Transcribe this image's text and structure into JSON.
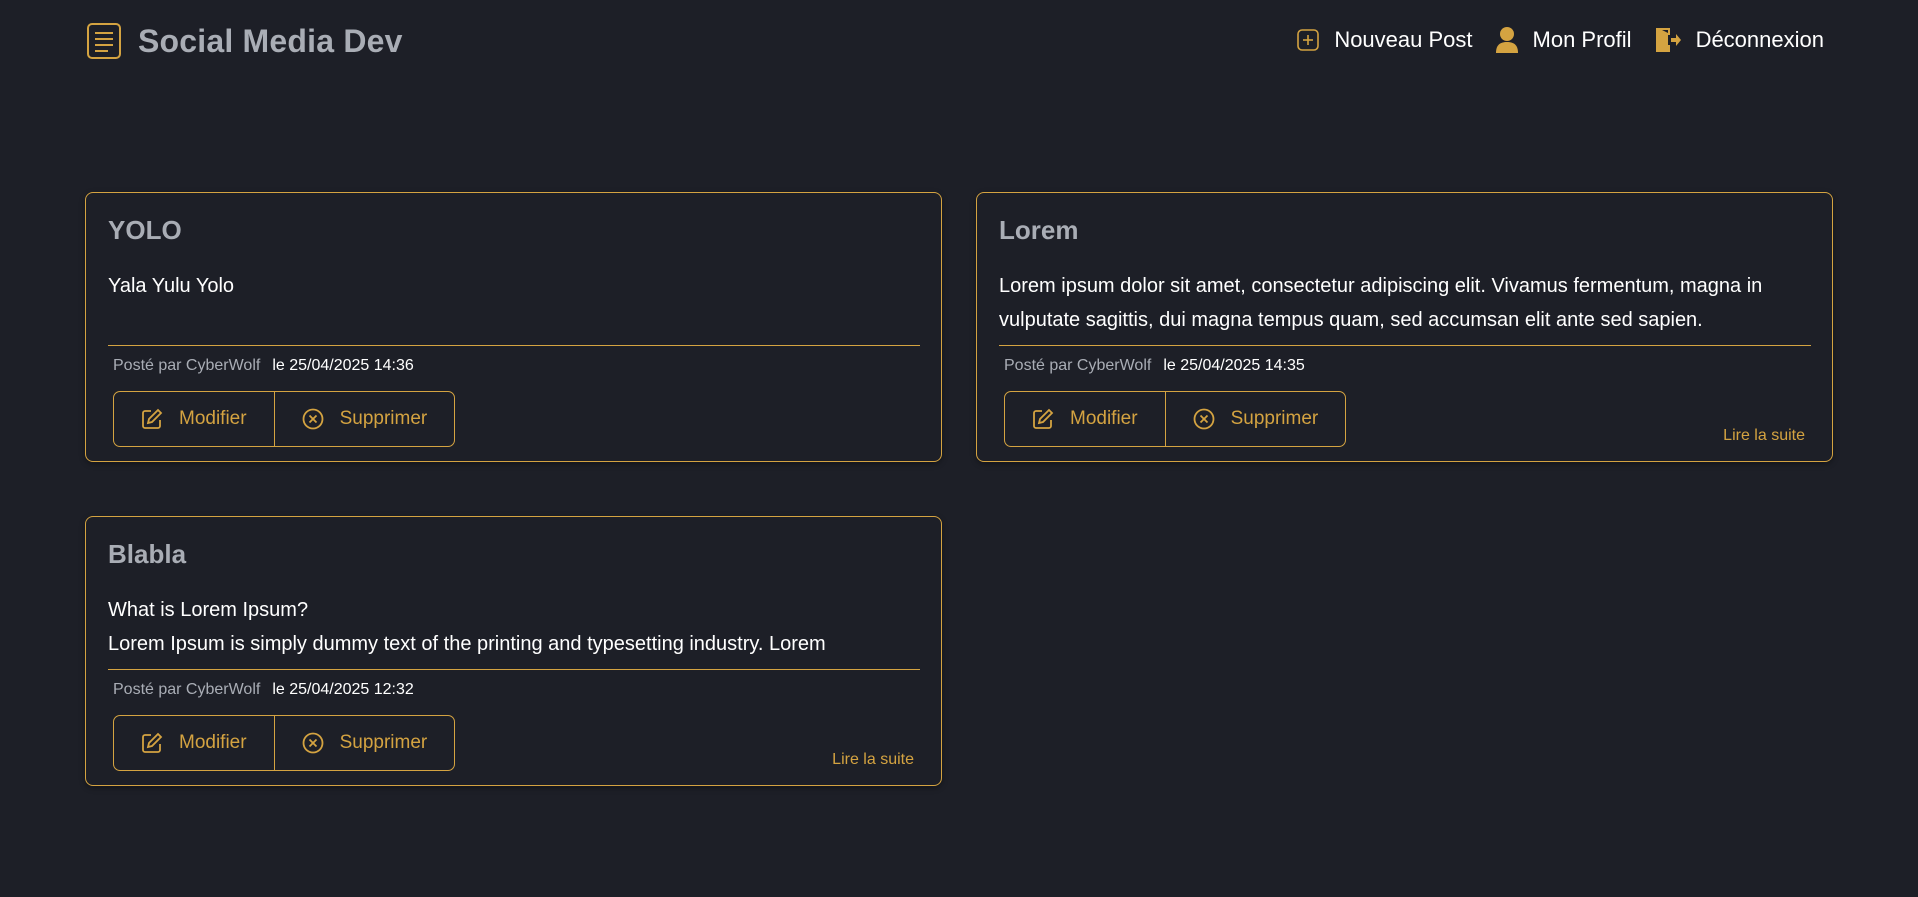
{
  "app": {
    "brand": "Social Media Dev",
    "accent_color": "#d4a341",
    "background_color": "#1d1f27",
    "muted_text_color": "#a9adb5"
  },
  "nav": {
    "new_post": {
      "label": "Nouveau Post",
      "icon": "plus-square-icon"
    },
    "profile": {
      "label": "Mon Profil",
      "icon": "user-icon"
    },
    "logout": {
      "label": "Déconnexion",
      "icon": "door-exit-icon"
    }
  },
  "posts": [
    {
      "title": "YOLO",
      "body": "Yala Yulu Yolo",
      "author": "Posté par CyberWolf",
      "date": "le 25/04/2025 14:36",
      "edit_label": "Modifier",
      "delete_label": "Supprimer",
      "read_more": ""
    },
    {
      "title": "Lorem",
      "body": "Lorem ipsum dolor sit amet, consectetur adipiscing elit. Vivamus fermentum, magna in vulputate sagittis, dui magna tempus quam, sed accumsan elit ante sed sapien.",
      "author": "Posté par CyberWolf",
      "date": "le 25/04/2025 14:35",
      "edit_label": "Modifier",
      "delete_label": "Supprimer",
      "read_more": "Lire la suite"
    },
    {
      "title": "Blabla",
      "body": "What is Lorem Ipsum?\nLorem Ipsum is simply dummy text of the printing and typesetting industry. Lorem",
      "author": "Posté par CyberWolf",
      "date": "le 25/04/2025 12:32",
      "edit_label": "Modifier",
      "delete_label": "Supprimer",
      "read_more": "Lire la suite"
    }
  ]
}
